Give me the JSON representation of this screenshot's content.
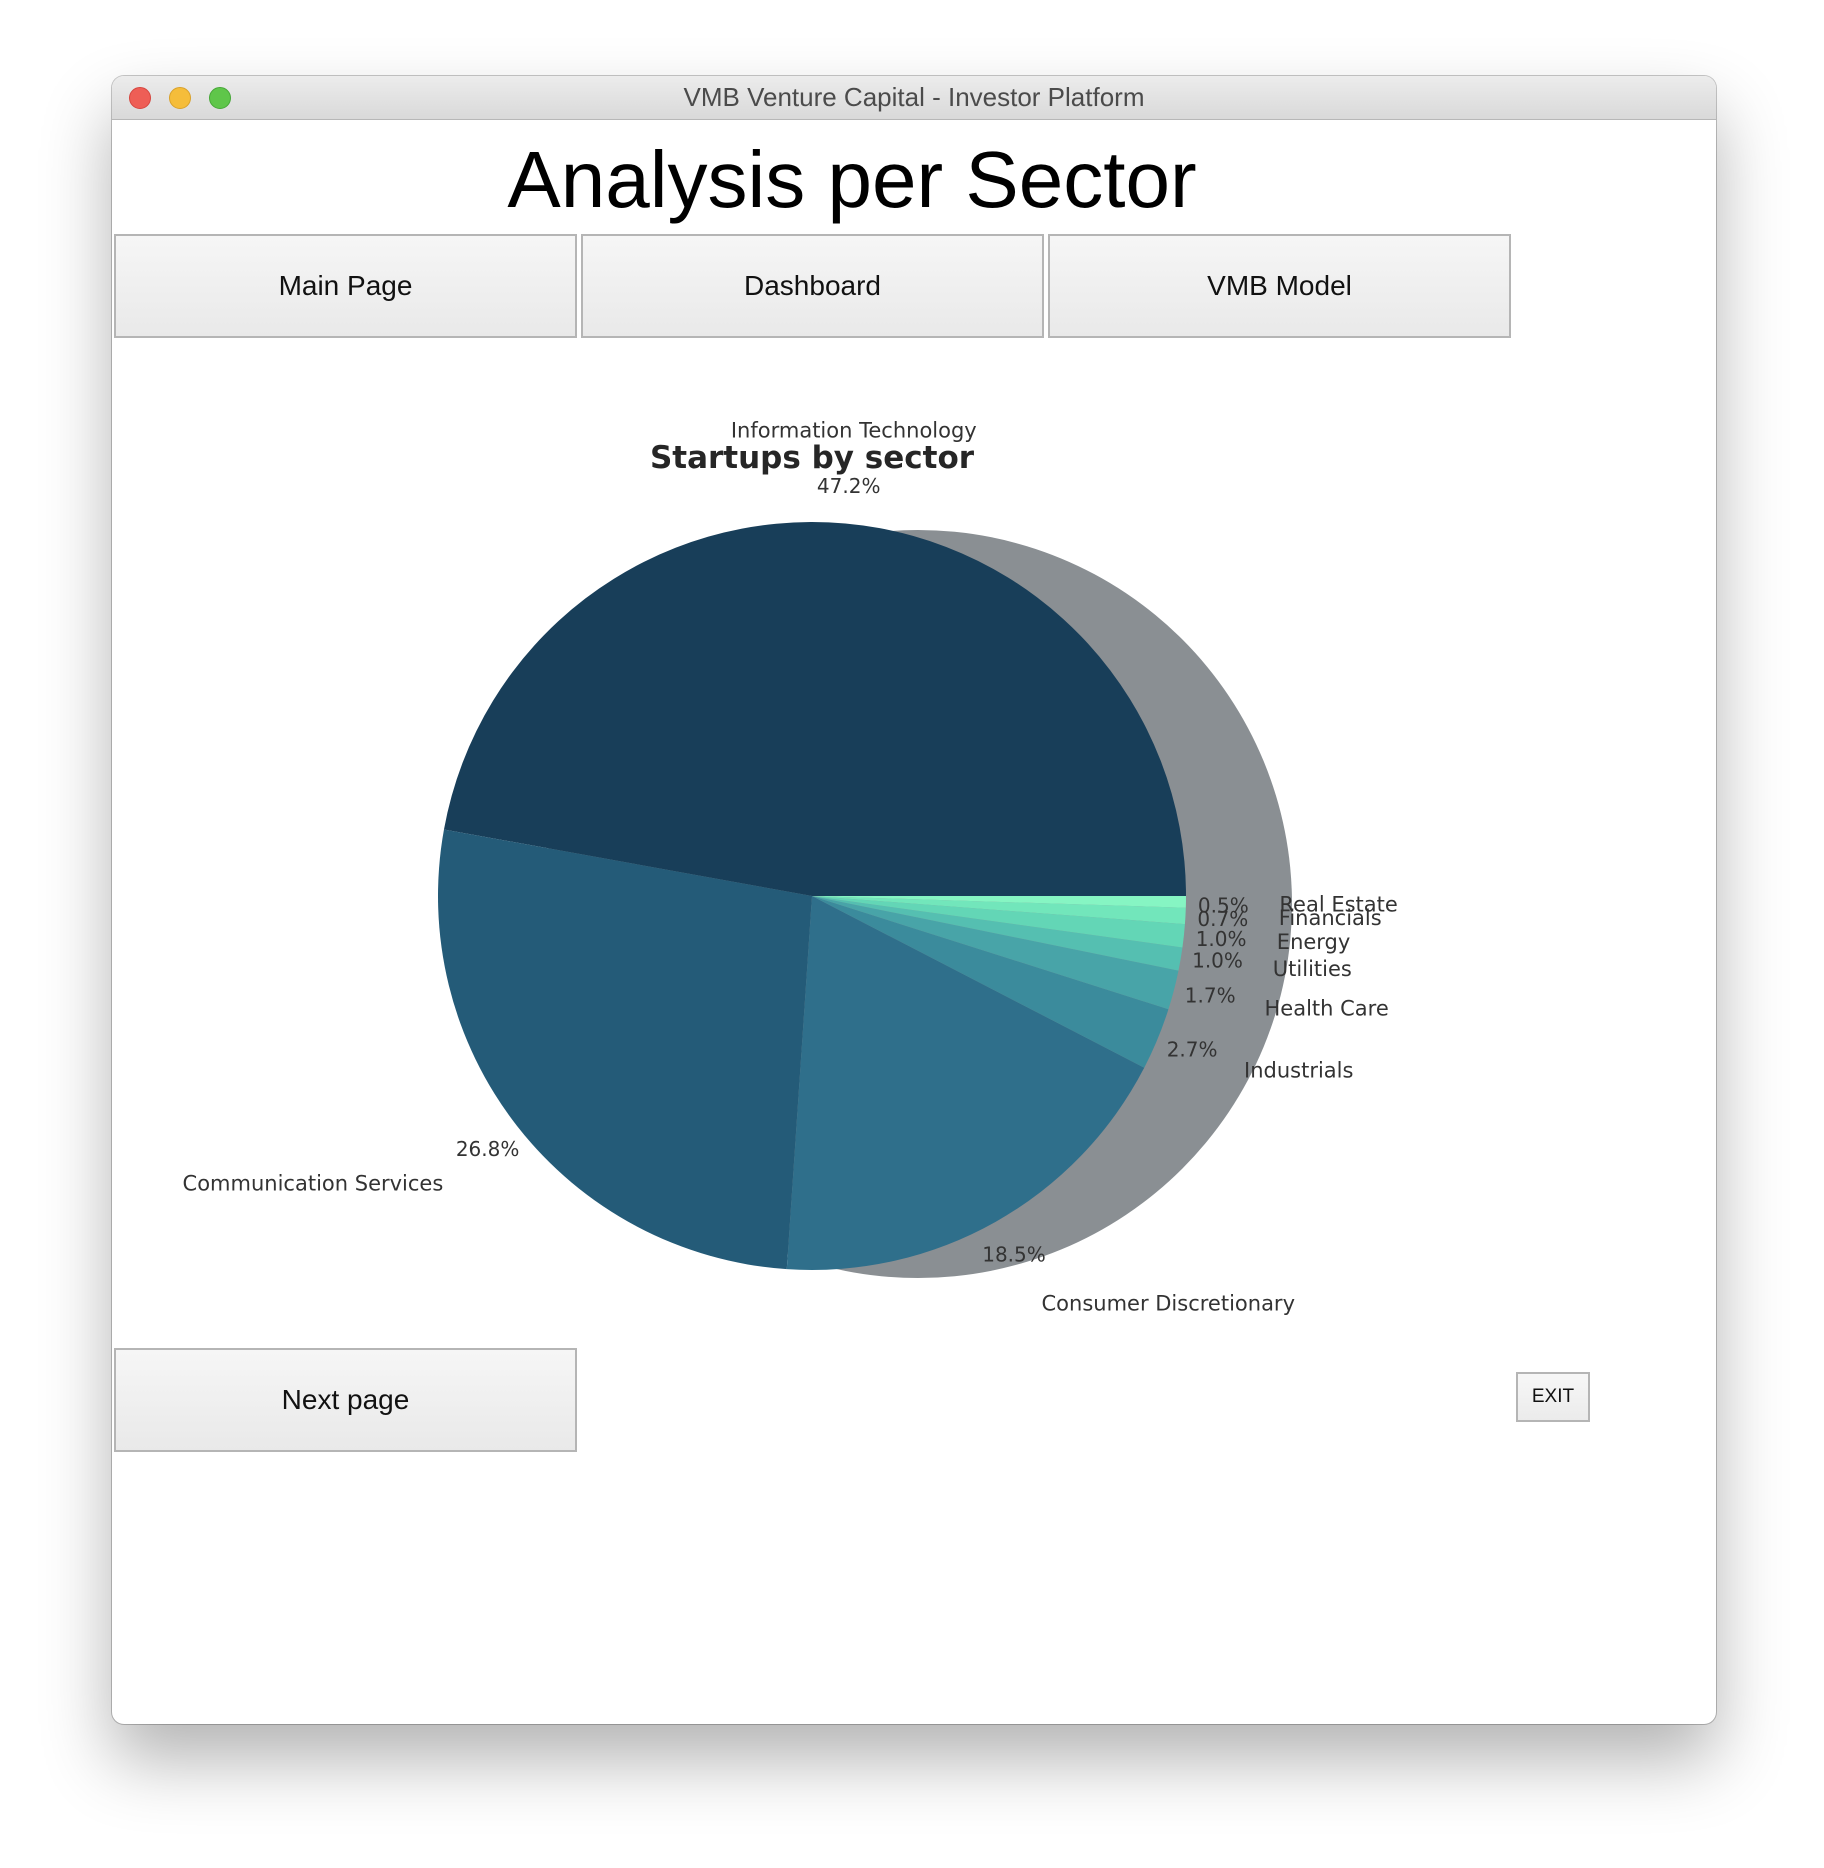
{
  "window": {
    "title": "VMB Venture Capital - Investor Platform"
  },
  "page": {
    "heading": "Analysis per Sector"
  },
  "nav": {
    "main_page_label": "Main Page",
    "dashboard_label": "Dashboard",
    "vmb_model_label": "VMB Model"
  },
  "footer": {
    "next_page_label": "Next page",
    "exit_label": "EXIT"
  },
  "chart_data": {
    "type": "pie",
    "title": "Startups by sector",
    "shadow": true,
    "start_angle_deg": 0,
    "direction": "counterclockwise",
    "slices": [
      {
        "label": "Information Technology",
        "value": 47.2,
        "pct_text": "47.2%",
        "color": "#183e59"
      },
      {
        "label": "Communication Services",
        "value": 26.8,
        "pct_text": "26.8%",
        "color": "#245b78"
      },
      {
        "label": "Consumer Discretionary",
        "value": 18.5,
        "pct_text": "18.5%",
        "color": "#2f6f8b"
      },
      {
        "label": "Industrials",
        "value": 2.7,
        "pct_text": "2.7%",
        "color": "#3b8b9c"
      },
      {
        "label": "Health Care",
        "value": 1.7,
        "pct_text": "1.7%",
        "color": "#48a4a8"
      },
      {
        "label": "Utilities",
        "value": 1.0,
        "pct_text": "1.0%",
        "color": "#55bfb1"
      },
      {
        "label": "Energy",
        "value": 1.0,
        "pct_text": "1.0%",
        "color": "#63d6b6"
      },
      {
        "label": "Financials",
        "value": 0.7,
        "pct_text": "0.7%",
        "color": "#72e6bb"
      },
      {
        "label": "Real Estate",
        "value": 0.5,
        "pct_text": "0.5%",
        "color": "#86f5c3"
      }
    ]
  }
}
